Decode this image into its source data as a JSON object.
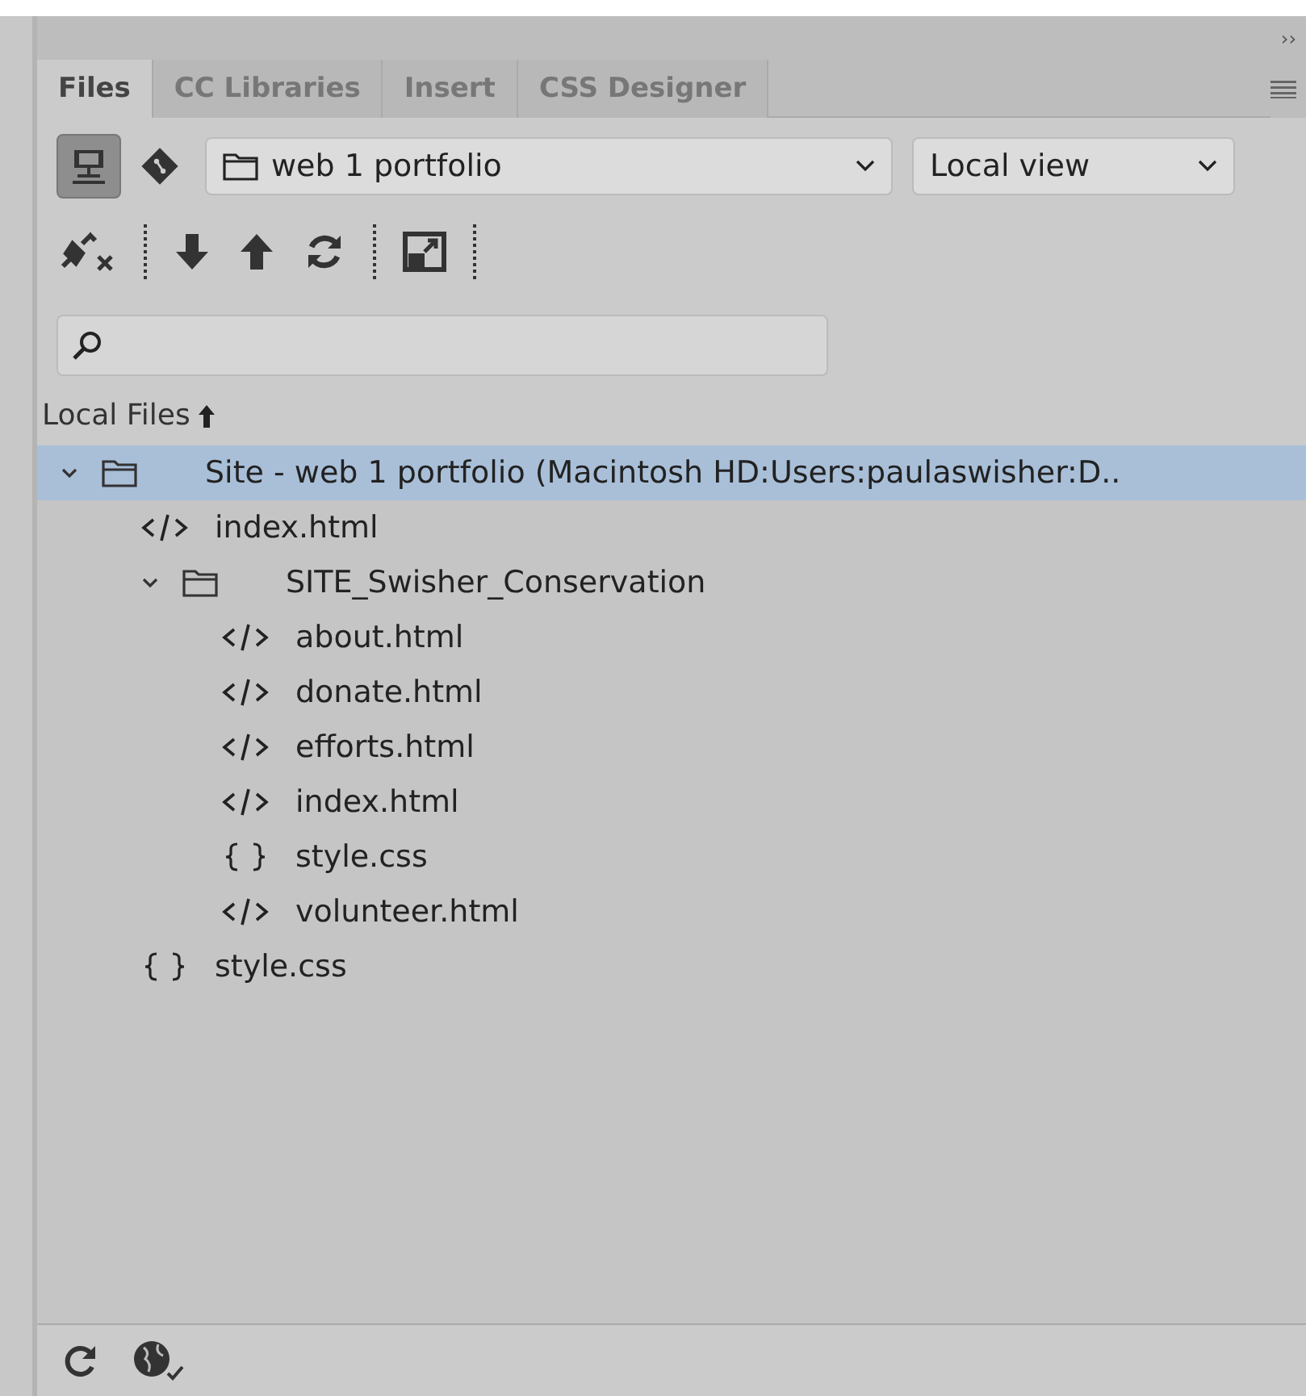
{
  "panel_collapse": "››",
  "tabs": [
    {
      "label": "Files",
      "selected": true
    },
    {
      "label": "CC Libraries",
      "selected": false
    },
    {
      "label": "Insert",
      "selected": false
    },
    {
      "label": "CSS Designer",
      "selected": false
    }
  ],
  "toolbar": {
    "site_view_toggle_on": true,
    "site_select": "web 1 portfolio",
    "view_select": "Local view"
  },
  "list_heading": "Local Files",
  "tree": [
    {
      "kind": "folder",
      "name": "Site - web 1 portfolio (Macintosh HD:Users:paulaswisher:D..",
      "expanded": true,
      "selected": true,
      "children": [
        {
          "kind": "html",
          "name": "index.html",
          "selected": false
        },
        {
          "kind": "folder",
          "name": "SITE_Swisher_Conservation",
          "expanded": true,
          "selected": false,
          "children": [
            {
              "kind": "html",
              "name": "about.html",
              "selected": false
            },
            {
              "kind": "html",
              "name": "donate.html",
              "selected": false
            },
            {
              "kind": "html",
              "name": "efforts.html",
              "selected": false
            },
            {
              "kind": "html",
              "name": "index.html",
              "selected": false
            },
            {
              "kind": "css",
              "name": "style.css",
              "selected": false
            },
            {
              "kind": "html",
              "name": "volunteer.html",
              "selected": false
            }
          ]
        },
        {
          "kind": "css",
          "name": "style.css",
          "selected": false
        }
      ]
    }
  ]
}
